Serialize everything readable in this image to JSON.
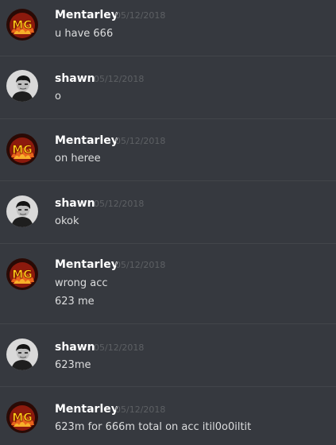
{
  "messages": [
    {
      "author": "Mentarley",
      "avatar": "mg-logo-avatar",
      "timestamp": "05/12/2018",
      "lines": [
        "u have 666"
      ]
    },
    {
      "author": "shawn",
      "avatar": "shawn-avatar",
      "timestamp": "05/12/2018",
      "lines": [
        "o"
      ]
    },
    {
      "author": "Mentarley",
      "avatar": "mg-logo-avatar",
      "timestamp": "05/12/2018",
      "lines": [
        "on heree"
      ]
    },
    {
      "author": "shawn",
      "avatar": "shawn-avatar",
      "timestamp": "05/12/2018",
      "lines": [
        "okok"
      ]
    },
    {
      "author": "Mentarley",
      "avatar": "mg-logo-avatar",
      "timestamp": "05/12/2018",
      "lines": [
        "wrong acc",
        "623 me"
      ]
    },
    {
      "author": "shawn",
      "avatar": "shawn-avatar",
      "timestamp": "05/12/2018",
      "lines": [
        "623me"
      ]
    },
    {
      "author": "Mentarley",
      "avatar": "mg-logo-avatar",
      "timestamp": "05/12/2018",
      "lines": [
        "623m for 666m total on acc itil0o0iltit"
      ]
    }
  ],
  "avatars": {
    "mg-logo-avatar": {
      "logo_text": "MG"
    }
  },
  "colors": {
    "background": "#36393f",
    "divider": "#42454a",
    "username": "#ffffff",
    "timestamp": "#5d6064",
    "message_text": "#dcddde"
  }
}
